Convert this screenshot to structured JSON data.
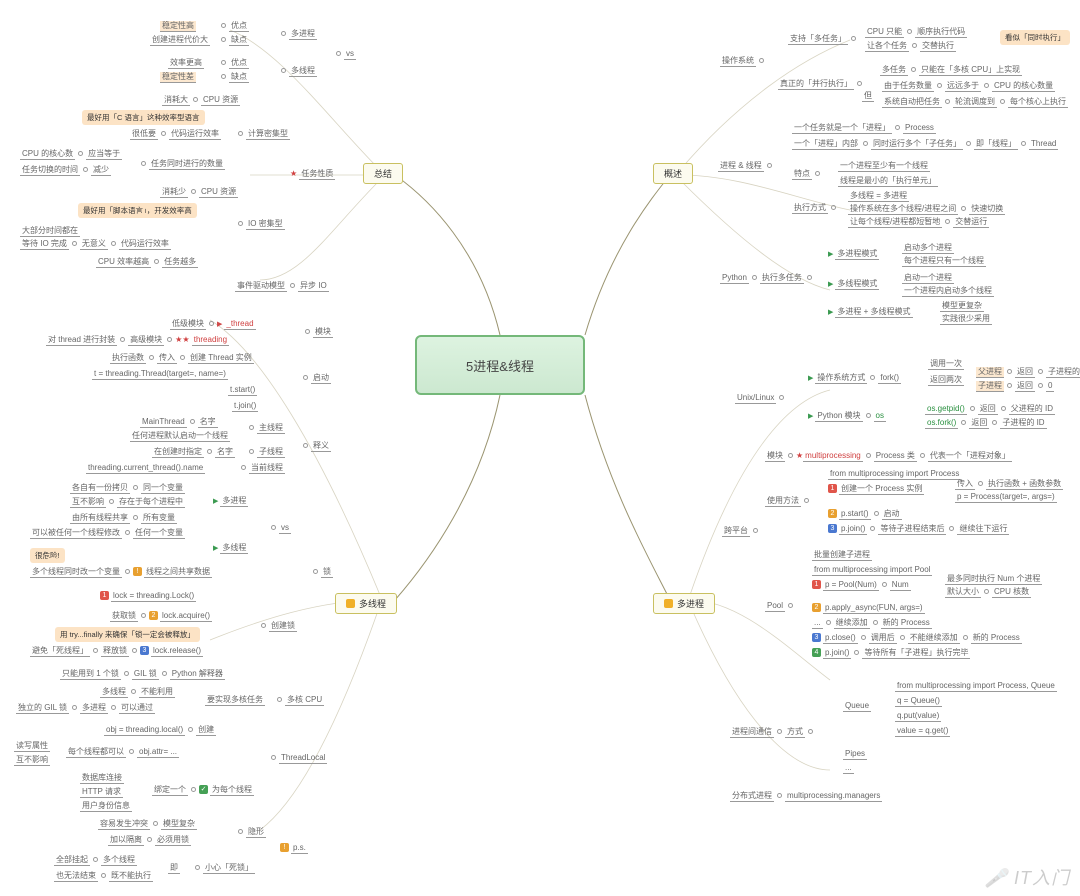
{
  "center": "5进程&线程",
  "hubs": {
    "summary": "总结",
    "overview": "概述",
    "mthread": "多线程",
    "mproc": "多进程"
  },
  "summary": {
    "vs": {
      "label": "vs",
      "mp": {
        "label": "多进程",
        "pros": "优点",
        "cons": "缺点",
        "pros_d": "稳定性高",
        "cons_d": "创建进程代价大"
      },
      "mt": {
        "label": "多线程",
        "pros": "优点",
        "cons": "缺点",
        "pros_d": "效率更高",
        "cons_d": "稳定性差"
      }
    },
    "nature": {
      "label": "任务性质",
      "star": "★",
      "cpu": {
        "label": "计算密集型",
        "res": "消耗大",
        "res2": "CPU 资源",
        "tip": "最好用「C 语言」这种效率型语言",
        "low": "很低要",
        "low2": "代码运行效率",
        "taskcnt": "任务同时进行的数量",
        "core": "CPU 的核心数",
        "core2": "应当等于",
        "switch": "任务切换的时间",
        "switch2": "减少"
      },
      "io": {
        "label": "IO 密集型",
        "res": "消耗少",
        "res2": "CPU 资源",
        "tip": "最好用「脚本语言」，开发效率高",
        "wait": "大部分时间都在",
        "wait2": "等待 IO 完成",
        "mean": "无意义",
        "mean2": "代码运行效率",
        "more": "CPU 效率越高",
        "more2": "任务越多"
      }
    },
    "event": {
      "label": "事件驱动模型",
      "sub": "异步 IO"
    }
  },
  "overview": {
    "os": {
      "label": "操作系统",
      "multitask": {
        "label": "支持「多任务」",
        "cpu": "CPU 只能",
        "seq": "顺序执行代码",
        "each": "让各个任务",
        "alt": "交替执行",
        "tip": "看似「同时执行」"
      },
      "parallel": {
        "label": "真正的「并行执行」",
        "mt": "多任务",
        "only": "只能在「多核 CPU」上实现",
        "but": "但",
        "r1a": "由于任务数量",
        "r1b": "远远多于",
        "r1c": "CPU 的核心数量",
        "r2a": "系统自动把任务",
        "r2b": "轮流调度到",
        "r2c": "每个核心上执行"
      }
    },
    "pt": {
      "label": "进程 & 线程",
      "p": "一个任务就是一个「进程」",
      "p2": "Process",
      "sub": "一个「进程」内部",
      "sub2": "同时运行多个「子任务」",
      "sub3": "即「线程」",
      "sub4": "Thread",
      "feat": {
        "label": "特点",
        "f1": "一个进程至少有一个线程",
        "f2": "线程是最小的「执行单元」"
      },
      "mode": {
        "label": "执行方式",
        "m1": "多线程 = 多进程",
        "m2": "操作系统在多个线程/进程之间",
        "m2b": "快速切换",
        "m3": "让每个线程/进程都短暂地",
        "m3b": "交替运行"
      }
    },
    "py": {
      "label": "Python",
      "run": "执行多任务",
      "mp": {
        "label": "多进程模式",
        "a": "启动多个进程",
        "b": "每个进程只有一个线程",
        "flag": "flag-g"
      },
      "mt": {
        "label": "多线程模式",
        "a": "启动一个进程",
        "b": "一个进程内启动多个线程",
        "flag": "flag-g"
      },
      "mix": {
        "label": "多进程 + 多线程模式",
        "a": "模型更复杂",
        "b": "实践很少采用",
        "flag": "flag-g"
      }
    }
  },
  "mthread": {
    "mod": {
      "label": "模块",
      "low": "低级模块",
      "low2": "_thread",
      "hi": "高级模块",
      "hi2": "threading",
      "star": "★★"
    },
    "start": {
      "label": "启动",
      "fn": "执行函数",
      "in": "传入",
      "cr": "创建 Thread 实例",
      "code1": "t = threading.Thread(target=, name=)",
      "code2": "t.start()",
      "code3": "t.join()"
    },
    "names": {
      "label": "释义",
      "main": "主线程",
      "main_n": "MainThread",
      "main_a": "名字",
      "main_b": "任何进程默认启动一个线程",
      "child": "子线程",
      "child_a": "在创建时指定",
      "child_b": "名字",
      "cur": "当前线程",
      "cur_c": "threading.current_thread().name"
    },
    "lock": {
      "label": "锁",
      "vs": {
        "label": "vs",
        "mp": {
          "label": "多进程",
          "a": "各自有一份拷贝",
          "a2": "同一个变量",
          "b": "互不影响",
          "b2": "存在于每个进程中"
        },
        "mt": {
          "label": "多线程",
          "a": "由所有线程共享",
          "a2": "所有变量",
          "b": "可以被任何一个线程修改",
          "b2": "任何一个变量",
          "tip": "很危险!",
          "share": "多个线程同时改一个变量",
          "share2": "线程之间共享数据"
        }
      },
      "create": {
        "label": "创建锁",
        "c1": "lock = threading.Lock()",
        "acq": "获取锁",
        "acq2": "lock.acquire()",
        "tip": "用 try...finally 来确保「锁一定会被释放」",
        "rel": "避免「死线程」",
        "rel2": "释放锁",
        "rel3": "lock.release()"
      }
    },
    "cpu": {
      "label": "多核 CPU",
      "gil": "只能用到 1 个锁",
      "gil2": "GIL 锁",
      "gil3": "Python 解释器",
      "mt": "多线程",
      "mt2": "不能利用",
      "need": "要实现多核任务",
      "ind": "独立的 GIL 锁",
      "ind2": "多进程",
      "ind3": "可以通过"
    },
    "tl": {
      "label": "ThreadLocal",
      "c1": "obj = threading.local()",
      "c1b": "创建",
      "each": "每个线程都可以",
      "each2": "obj.attr= ...",
      "rw": "读写属性",
      "rw2": "互不影响",
      "bind": "绑定一个",
      "bind2": "为每个线程",
      "b1": "数据库连接",
      "b2": "HTTP 请求",
      "b3": "用户身份信息"
    },
    "ps": {
      "label": "p.s.",
      "inv": "隐形",
      "inv_a": "容易发生冲突",
      "inv_b": "模型复杂",
      "inv_c": "加以隔离",
      "inv_d": "必须用锁",
      "dead": "小心「死锁」",
      "dead_a": "全部挂起",
      "dead_b": "多个线程",
      "dead_c": "也无法结束",
      "dead_d": "既不能执行",
      "dead_e": "即"
    }
  },
  "mproc": {
    "unix": {
      "label": "Unix/Linux",
      "os": {
        "label": "操作系统方式",
        "fn": "fork()",
        "once": "调用一次",
        "ret": "返回两次",
        "pp": "父进程",
        "pp_r": "返回",
        "pp_v": "子进程的 ID",
        "cp": "子进程",
        "cp_r": "返回",
        "cp_v": "0"
      },
      "py": {
        "label": "Python 模块",
        "mod": "os",
        "p1": "os.getpid()",
        "p1r": "返回",
        "p1v": "父进程的 ID",
        "p2": "os.fork()",
        "p2r": "返回",
        "p2v": "子进程的 ID"
      }
    },
    "cross": {
      "label": "跨平台",
      "mod": "模块",
      "modn": "multiprocessing",
      "cls": "Process 类",
      "cls2": "代表一个「进程对象」",
      "star": "★",
      "use": {
        "label": "使用方法",
        "imp": "from multiprocessing import Process",
        "s1n": "1",
        "s1": "创建一个 Process 实例",
        "s1a": "传入",
        "s1b": "执行函数 + 函数参数",
        "s1c": "p = Process(target=, args=)",
        "s2n": "2",
        "s2": "p.start()",
        "s2a": "启动",
        "s3n": "3",
        "s3": "p.join()",
        "s3a": "等待子进程结束后",
        "s3b": "继续往下运行"
      },
      "pool": {
        "label": "Pool",
        "title": "批量创建子进程",
        "imp": "from multiprocessing import Pool",
        "s1n": "1",
        "s1": "p = Pool(Num)",
        "s1a": "Num",
        "s1b": "最多同时执行 Num 个进程",
        "s1c": "默认大小",
        "s1d": "CPU 核数",
        "s2n": "2",
        "s2": "p.apply_async(FUN, args=)",
        "s3": "...",
        "s3a": "继续添加",
        "s3b": "新的 Process",
        "s4n": "3",
        "s4": "p.close()",
        "s4a": "调用后",
        "s4b": "不能继续添加",
        "s4c": "新的 Process",
        "s5n": "4",
        "s5": "p.join()",
        "s5a": "等待所有「子进程」执行完毕"
      }
    },
    "ipc": {
      "label": "进程间通信",
      "way": "方式",
      "q": {
        "label": "Queue",
        "imp": "from multiprocessing import Process, Queue",
        "c1": "q = Queue()",
        "c2": "q.put(value)",
        "c3": "value = q.get()"
      },
      "p": {
        "label": "Pipes",
        "dots": "..."
      }
    },
    "dist": {
      "label": "分布式进程",
      "mod": "multiprocessing.managers"
    }
  },
  "watermark": "🎤 IT入门"
}
